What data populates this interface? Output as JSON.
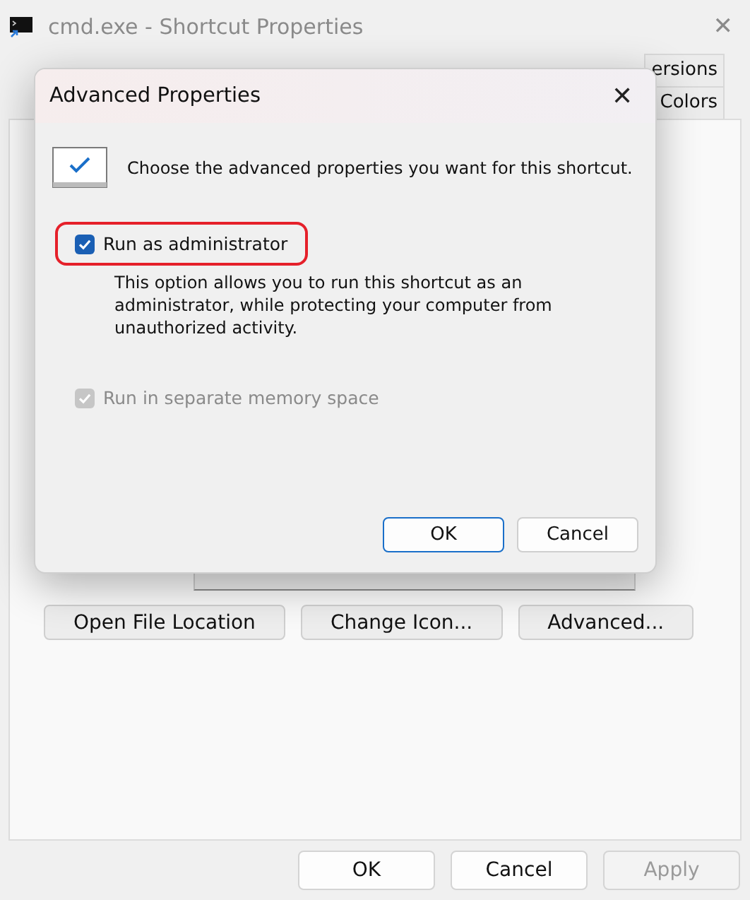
{
  "window": {
    "title": "cmd.exe - Shortcut Properties",
    "close": "✕"
  },
  "tabs": {
    "row_1": [
      {
        "label": "ersions",
        "selected": false
      }
    ],
    "row_2": [
      {
        "label": "Colors",
        "selected": false
      }
    ]
  },
  "buttons": [
    {
      "label": "Open File Location"
    },
    {
      "label": "Change Icon..."
    },
    {
      "label": "Advanced..."
    }
  ],
  "footer": [
    {
      "label": "OK",
      "disabled": false
    },
    {
      "label": "Cancel",
      "disabled": false
    },
    {
      "label": "Apply",
      "disabled": true
    }
  ],
  "dialog": {
    "title": "Advanced Properties",
    "close": "✕",
    "intro": "Choose the advanced properties you want for this shortcut.",
    "options": [
      {
        "label": "Run as administrator",
        "checked": true,
        "disabled": false,
        "highlighted": true,
        "description": "This option allows you to run this shortcut as an administrator, while protecting your computer from unauthorized activity."
      },
      {
        "label": "Run in separate memory space",
        "checked": true,
        "disabled": true,
        "highlighted": false
      }
    ],
    "buttons": [
      {
        "label": "OK",
        "default": true
      },
      {
        "label": "Cancel",
        "default": false
      }
    ]
  }
}
